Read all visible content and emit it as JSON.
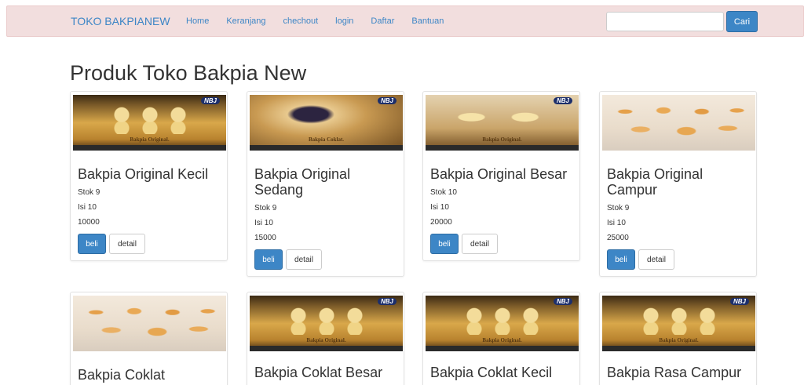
{
  "navbar": {
    "brand": "TOKO BAKPIANEW",
    "links": [
      "Home",
      "Keranjang",
      "chechout",
      "login",
      "Daftar",
      "Bantuan"
    ],
    "search": {
      "value": "",
      "button_label": "Cari"
    }
  },
  "page_title": "Produk Toko Bakpia New",
  "products": [
    {
      "name": "Bakpia Original Kecil",
      "stok": "Stok 9",
      "isi": "Isi 10",
      "harga": "10000",
      "beli_label": "beli",
      "detail_label": "detail",
      "image_caption": "Bakpia Original."
    },
    {
      "name": "Bakpia Original Sedang",
      "stok": "Stok 9",
      "isi": "Isi 10",
      "harga": "15000",
      "beli_label": "beli",
      "detail_label": "detail",
      "image_caption": "Bakpia Coklat."
    },
    {
      "name": "Bakpia Original Besar",
      "stok": "Stok 10",
      "isi": "Isi 10",
      "harga": "20000",
      "beli_label": "beli",
      "detail_label": "detail",
      "image_caption": "Bakpia Original."
    },
    {
      "name": "Bakpia Original Campur",
      "stok": "Stok 9",
      "isi": "Isi 10",
      "harga": "25000",
      "beli_label": "beli",
      "detail_label": "detail"
    },
    {
      "name": "Bakpia Coklat"
    },
    {
      "name": "Bakpia Coklat Besar",
      "image_caption": "Bakpia Original."
    },
    {
      "name": "Bakpia Coklat Kecil",
      "image_caption": "Bakpia Original."
    },
    {
      "name": "Bakpia Rasa Campur",
      "image_caption": "Bakpia Original."
    }
  ],
  "logo_text": "NBJ"
}
